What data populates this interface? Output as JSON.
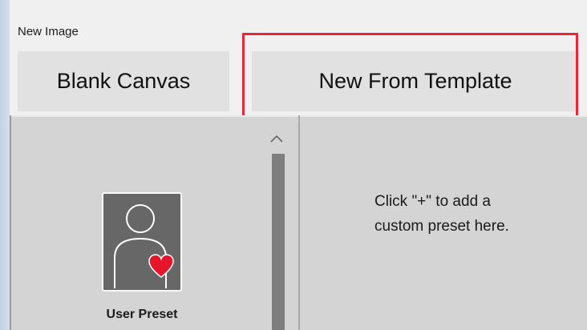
{
  "window": {
    "title": "New Image"
  },
  "tabs": [
    {
      "label": "Blank Canvas",
      "selected": false
    },
    {
      "label": "New From Template",
      "selected": false
    }
  ],
  "preset_list": {
    "items": [
      {
        "label": "User Preset",
        "icon": "user-heart-icon"
      }
    ],
    "scroll_up_icon": "chevron-up-icon"
  },
  "detail_panel": {
    "hint_line1": "Click \"+\" to add a",
    "hint_line2": "custom preset here."
  },
  "colors": {
    "highlight": "#e8283a",
    "heart": "#e5152a",
    "tab_background": "#e1e1e1",
    "panel_background": "#d4d4d4"
  }
}
